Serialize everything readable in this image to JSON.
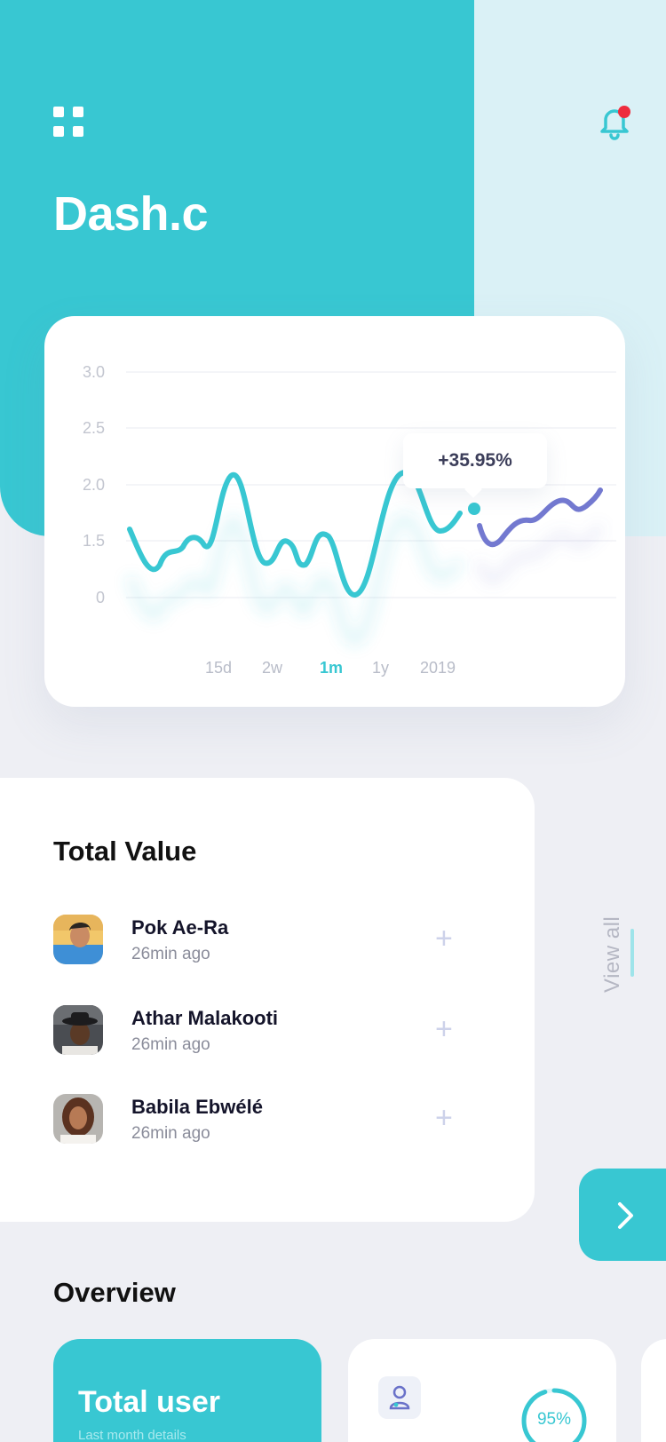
{
  "header": {
    "title": "Dash.c"
  },
  "chart": {
    "y_ticks": [
      "3.0",
      "2.5",
      "2.0",
      "1.5",
      "0"
    ],
    "tooltip": "+35.95%",
    "ranges": [
      "15d",
      "2w",
      "1m",
      "1y",
      "2019"
    ],
    "active_range": "1m",
    "colors": {
      "primary": "#38c7d2",
      "secondary": "#7379d0"
    }
  },
  "total_value": {
    "title": "Total Value",
    "items": [
      {
        "name": "Pok Ae-Ra",
        "time": "26min ago"
      },
      {
        "name": "Athar Malakooti",
        "time": "26min ago"
      },
      {
        "name": "Babila Ebwélé",
        "time": "26min ago"
      }
    ],
    "view_all": "View all"
  },
  "overview": {
    "title": "Overview",
    "total_user": {
      "title": "Total user",
      "subtitle": "Last month details"
    },
    "stat": {
      "percent": "95%",
      "progress": 0.95
    }
  },
  "colors": {
    "accent": "#38c7d2",
    "accent_light": "#daf1f6",
    "notification": "#ee2d3e"
  }
}
